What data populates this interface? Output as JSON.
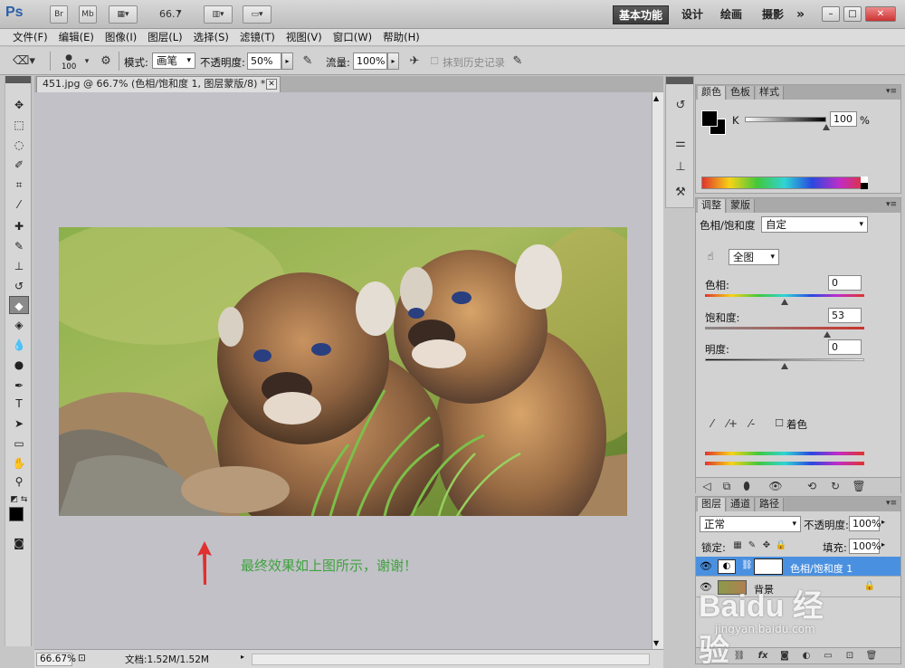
{
  "titlebar": {
    "app_logo": "Ps",
    "bridge": "Br",
    "minibridge": "Mb",
    "zoom_value": "66.7",
    "workspaces": [
      "基本功能",
      "设计",
      "绘画",
      "摄影"
    ],
    "more": "»",
    "win_min": "–",
    "win_max": "□",
    "win_close": "✕"
  },
  "menu": [
    "文件(F)",
    "编辑(E)",
    "图像(I)",
    "图层(L)",
    "选择(S)",
    "滤镜(T)",
    "视图(V)",
    "窗口(W)",
    "帮助(H)"
  ],
  "options": {
    "brush_size": "100",
    "mode_label": "模式:",
    "mode_value": "画笔",
    "opacity_label": "不透明度:",
    "opacity_value": "50%",
    "flow_label": "流量:",
    "flow_value": "100%",
    "history_label": "抹到历史记录"
  },
  "document": {
    "tab_title": "451.jpg @ 66.7% (色相/饱和度 1, 图层蒙版/8) *",
    "caption": "最终效果如上图所示，谢谢！"
  },
  "status": {
    "zoom": "66.67%",
    "doc_info": "文档:1.52M/1.52M"
  },
  "color_panel": {
    "tabs": [
      "颜色",
      "色板",
      "样式"
    ],
    "channel": "K",
    "k_value": "100",
    "k_unit": "%",
    "k_level": 1.0
  },
  "adjust_panel": {
    "tabs": [
      "调整",
      "蒙版"
    ],
    "title": "色相/饱和度",
    "preset": "自定",
    "range": "全图",
    "hue_label": "色相:",
    "hue_value": "0",
    "hue_level": 0.5,
    "sat_label": "饱和度:",
    "sat_value": "53",
    "sat_level": 0.765,
    "light_label": "明度:",
    "light_value": "0",
    "light_level": 0.5,
    "colorize_label": "着色"
  },
  "layers_panel": {
    "tabs": [
      "图层",
      "通道",
      "路径"
    ],
    "blend_mode": "正常",
    "opacity_label": "不透明度:",
    "opacity_value": "100%",
    "lock_label": "锁定:",
    "fill_label": "填充:",
    "fill_value": "100%",
    "layers": [
      {
        "name": "色相/饱和度 1",
        "selected": true
      },
      {
        "name": "背景",
        "selected": false,
        "locked": true
      }
    ]
  },
  "watermark": {
    "logo": "Baidu 经验",
    "url": "jingyan.baidu.com"
  },
  "colors": {
    "accent_selected": "#4a90e0",
    "caption_green": "#3fa23f",
    "arrow_red": "#e03030"
  }
}
